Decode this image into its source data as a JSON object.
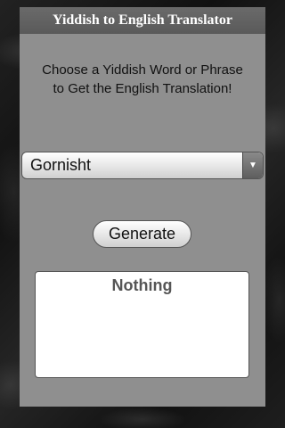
{
  "app": {
    "title": "Yiddish to English Translator"
  },
  "instructions": {
    "text": "Choose a Yiddish Word or Phrase\nto Get the English Translation!"
  },
  "word_select": {
    "selected_value": "Gornisht",
    "arrow_icon": "triangle-down-icon"
  },
  "generate_button": {
    "label": "Generate"
  },
  "result": {
    "text": "Nothing"
  },
  "colors": {
    "panel": "#8f8f8f",
    "title_bar": "#5e5e5e",
    "title_text": "#ffffff",
    "result_text": "#555555"
  }
}
